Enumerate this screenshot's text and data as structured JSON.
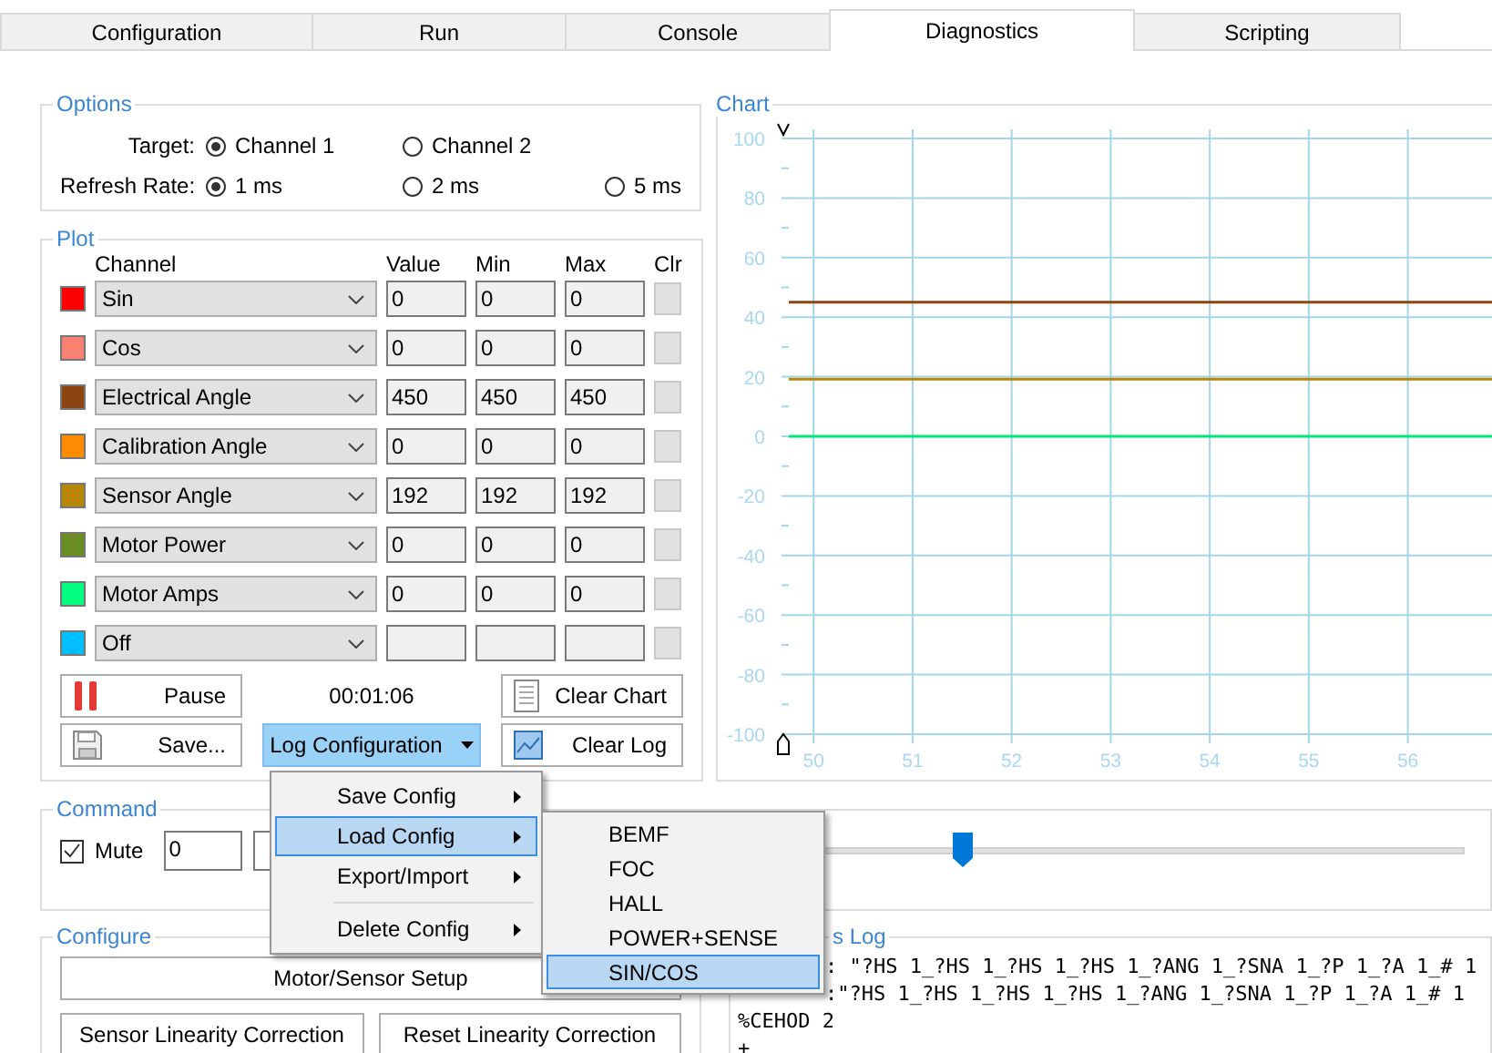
{
  "tabs": [
    {
      "label": "Configuration",
      "selected": false
    },
    {
      "label": "Run",
      "selected": false
    },
    {
      "label": "Console",
      "selected": false
    },
    {
      "label": "Diagnostics",
      "selected": true
    },
    {
      "label": "Scripting",
      "selected": false
    }
  ],
  "options": {
    "title": "Options",
    "rows": [
      {
        "label": "Target:",
        "choices": [
          {
            "label": "Channel 1",
            "selected": true
          },
          {
            "label": "Channel 2",
            "selected": false
          }
        ]
      },
      {
        "label": "Refresh Rate:",
        "choices": [
          {
            "label": "1 ms",
            "selected": true
          },
          {
            "label": "2 ms",
            "selected": false
          },
          {
            "label": "5 ms",
            "selected": false
          }
        ]
      }
    ]
  },
  "plot": {
    "title": "Plot",
    "columns": [
      "Channel",
      "Value",
      "Min",
      "Max",
      "Clr"
    ],
    "rows": [
      {
        "color": "#ff0000",
        "channel": "Sin",
        "value": "0",
        "min": "0",
        "max": "0"
      },
      {
        "color": "#fa8072",
        "channel": "Cos",
        "value": "0",
        "min": "0",
        "max": "0"
      },
      {
        "color": "#8b4513",
        "channel": "Electrical Angle",
        "value": "450",
        "min": "450",
        "max": "450"
      },
      {
        "color": "#ff8c00",
        "channel": "Calibration Angle",
        "value": "0",
        "min": "0",
        "max": "0"
      },
      {
        "color": "#b8860b",
        "channel": "Sensor Angle",
        "value": "192",
        "min": "192",
        "max": "192"
      },
      {
        "color": "#6b8e23",
        "channel": "Motor Power",
        "value": "0",
        "min": "0",
        "max": "0"
      },
      {
        "color": "#00ff7f",
        "channel": "Motor Amps",
        "value": "0",
        "min": "0",
        "max": "0"
      },
      {
        "color": "#00bfff",
        "channel": "Off"
      }
    ],
    "pause_button": "Pause",
    "elapsed": "00:01:06",
    "clear_chart_button": "Clear Chart",
    "save_button": "Save...",
    "log_config_button": {
      "label": "Log Configuration",
      "expanded": true
    },
    "clear_log_button": "Clear Log"
  },
  "log_config_menu": [
    {
      "kind": "item",
      "label": "Save Config",
      "selected": false
    },
    {
      "kind": "item",
      "label": "Load Config",
      "selected": true
    },
    {
      "kind": "item",
      "label": "Export/Import",
      "selected": false
    },
    {
      "kind": "separator"
    },
    {
      "kind": "item",
      "label": "Delete Config",
      "selected": false
    }
  ],
  "load_config_submenu": [
    {
      "label": "BEMF",
      "selected": false
    },
    {
      "label": "FOC",
      "selected": false
    },
    {
      "label": "HALL",
      "selected": false
    },
    {
      "label": "POWER+SENSE",
      "selected": false
    },
    {
      "label": "SIN/COS",
      "selected": true
    }
  ],
  "chart": {
    "title": "Chart",
    "chart_data": {
      "type": "line",
      "x": [
        49.75,
        56.85
      ],
      "xlim": [
        49.75,
        56.85
      ],
      "ylim": [
        -100,
        100
      ],
      "xticks": [
        50,
        51,
        52,
        53,
        54,
        55,
        56
      ],
      "yticks": [
        -100,
        -80,
        -60,
        -40,
        -20,
        0,
        20,
        40,
        60,
        80,
        100
      ],
      "grid": true,
      "series": [
        {
          "color": "#8b4513",
          "values": [
            45,
            45
          ]
        },
        {
          "color": "#b8860b",
          "values": [
            19.2,
            19.2
          ]
        },
        {
          "color": "#00e676",
          "values": [
            0,
            0
          ]
        }
      ]
    }
  },
  "command": {
    "title": "Command",
    "mute": {
      "label": "Mute",
      "checked": true
    },
    "value": "0",
    "slider": {
      "level": 0.54
    }
  },
  "configure": {
    "title": "Configure",
    "buttons": [
      "Motor/Sensor Setup",
      "Sensor Linearity Correction",
      "Reset Linearity Correction"
    ]
  },
  "log": {
    "title": "s Log",
    "lines": [
      ": \"?HS 1_?HS 1_?HS 1_?HS 1_?ANG 1_?SNA 1_?P 1_?A 1_# 1",
      ":\"?HS 1_?HS 1_?HS 1_?HS 1_?ANG 1_?SNA 1_?P 1_?A 1_# 1",
      "%CEHOD 2",
      "+"
    ]
  }
}
